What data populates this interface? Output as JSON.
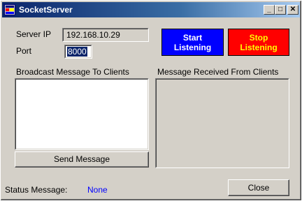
{
  "window": {
    "title": "SocketServer"
  },
  "titlebar": {
    "minimize_glyph": "_",
    "maximize_glyph": "□",
    "close_glyph": "✕"
  },
  "server": {
    "ip_label": "Server IP",
    "ip_value": "192.168.10.29",
    "port_label": "Port",
    "port_value": "8000"
  },
  "buttons": {
    "start_line1": "Start",
    "start_line2": "Listening",
    "stop_line1": "Stop",
    "stop_line2": "Listening",
    "send_message": "Send Message",
    "close": "Close"
  },
  "broadcast": {
    "label": "Broadcast Message To Clients",
    "value": ""
  },
  "received": {
    "label": "Message Received From Clients",
    "value": ""
  },
  "status": {
    "label": "Status Message:",
    "value": "None"
  },
  "colors": {
    "start_bg": "#0000ff",
    "stop_bg": "#ff0000",
    "stop_text": "#ffff00",
    "status_value": "#0000ff"
  },
  "icons": {
    "app": "app-window-icon"
  }
}
